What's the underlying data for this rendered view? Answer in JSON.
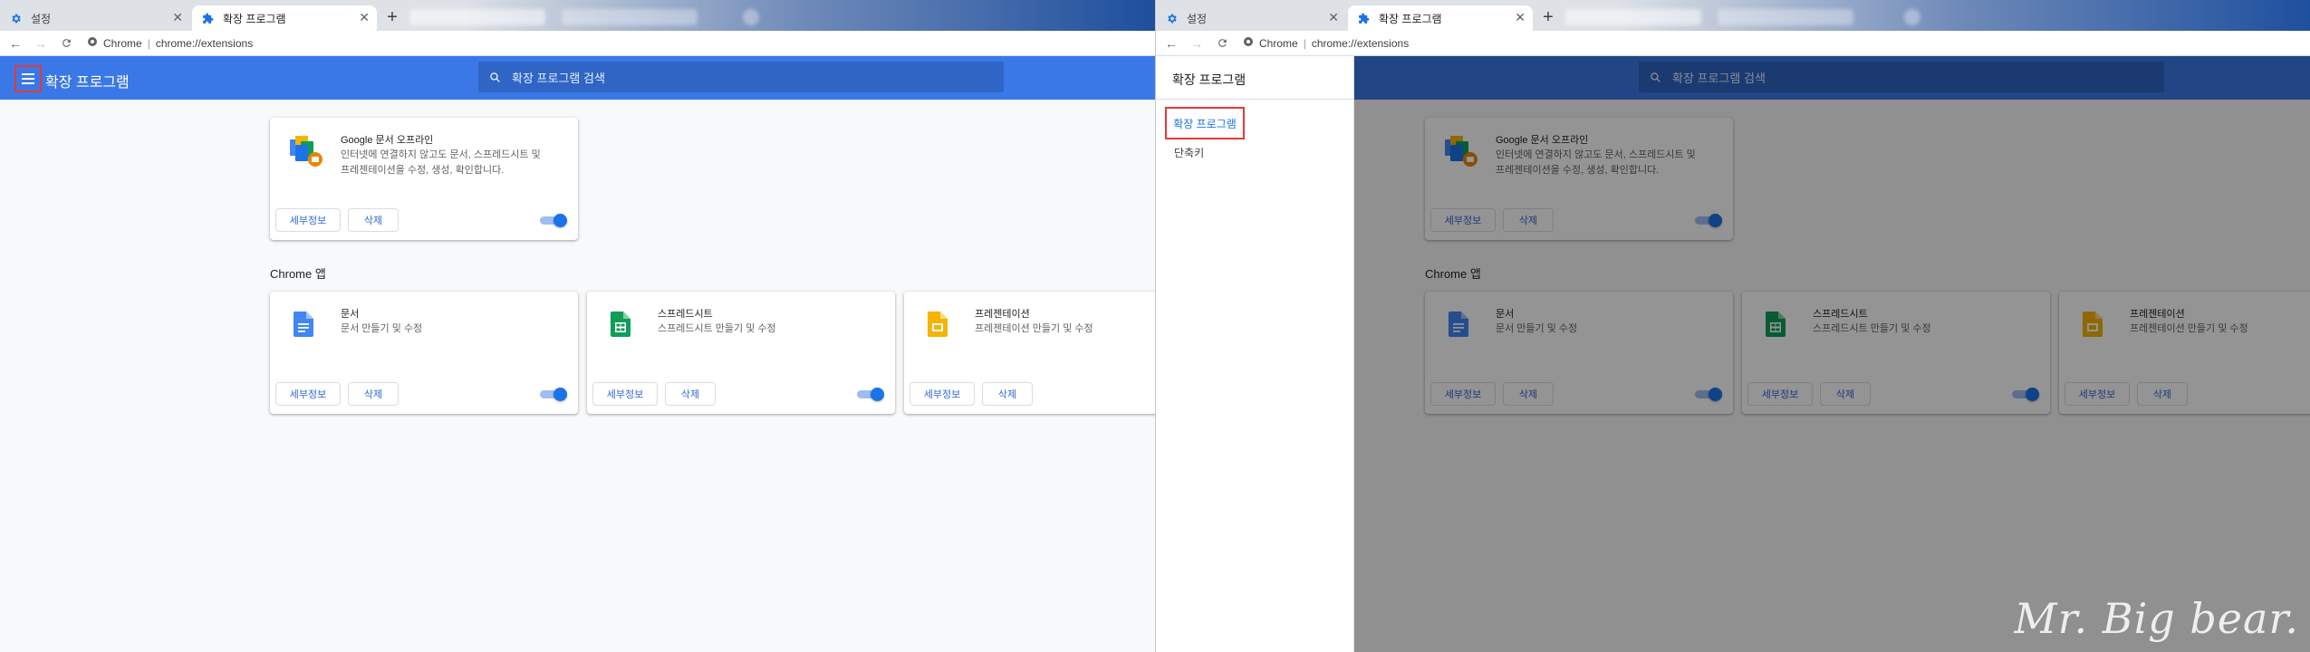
{
  "browser": {
    "tabs": [
      {
        "title": "설정",
        "icon": "gear-icon"
      },
      {
        "title": "확장 프로그램",
        "icon": "puzzle-icon"
      }
    ],
    "new_tab_symbol": "+",
    "close_symbol": "✕",
    "omnibox": {
      "site": "Chrome",
      "url": "chrome://extensions"
    }
  },
  "extensions_page": {
    "title": "확장 프로그램",
    "search_placeholder": "확장 프로그램 검색",
    "extension": {
      "name": "Google 문서 오프라인",
      "description_line1": "인터넷에 연결하지 않고도 문서, 스프레드시트 및",
      "description_line2": "프레젠테이션을 수정, 생성, 확인합니다.",
      "details_label": "세부정보",
      "remove_label": "삭제",
      "enabled": true
    },
    "apps_section_title": "Chrome 앱",
    "apps": [
      {
        "name": "문서",
        "description": "문서 만들기 및 수정",
        "icon": "docs-icon",
        "color": "#4285f4",
        "enabled": true
      },
      {
        "name": "스프레드시트",
        "description": "스프레드시트 만들기 및 수정",
        "icon": "sheets-icon",
        "color": "#0f9d58",
        "enabled": true
      },
      {
        "name": "프레젠테이션",
        "description": "프레젠테이션 만들기 및 수정",
        "icon": "slides-icon",
        "color": "#f4b400",
        "enabled": true
      }
    ],
    "details_label": "세부정보",
    "remove_label": "삭제"
  },
  "drawer": {
    "title": "확장 프로그램",
    "items": [
      {
        "label": "확장 프로그램"
      },
      {
        "label": "단축키"
      }
    ]
  },
  "watermark": "Mr. Big bear.",
  "colors": {
    "header_blue": "#3b78e7",
    "highlight_red": "#e53935",
    "link_blue": "#3367d6",
    "toggle_blue": "#1a73e8"
  }
}
